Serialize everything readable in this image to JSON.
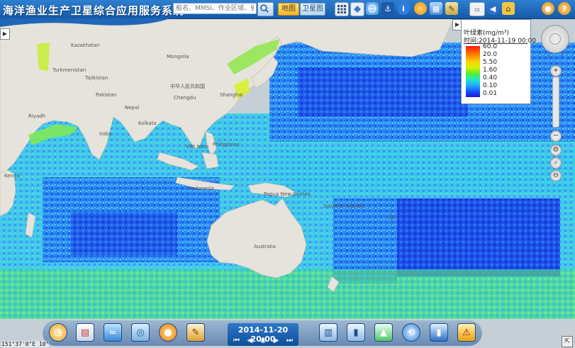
{
  "header": {
    "title": "海洋渔业生产卫星综合应用服务系统",
    "search_placeholder": "船名、MMSI、作业区域、省市",
    "tab_map": "地图",
    "tab_satellite": "卫星图",
    "tools": [
      "grid-icon",
      "layers-icon",
      "globe-icon",
      "anchor-icon",
      "info-icon",
      "weather-icon",
      "ruler-icon",
      "home-icon",
      "fishing-icon",
      "user-icon",
      "help-icon"
    ]
  },
  "legend": {
    "title": "叶绿素(mg/m³)",
    "time": "时间:2014-11-19 00:00",
    "values": [
      "60.0",
      "20.0",
      "5.50",
      "1.60",
      "0.40",
      "0.10",
      "0.01"
    ]
  },
  "map": {
    "labels": [
      "中华人民共和国",
      "Chengdu",
      "Shanghai",
      "India",
      "Nepal",
      "Pakistan",
      "Tajikistan",
      "Turkmenistan",
      "Kazakhstan",
      "Mongolia",
      "Kolkata",
      "Việt Nam",
      "Philippines",
      "Indonesia",
      "Papua New Guinea",
      "Australia",
      "Kenya",
      "Riyadh",
      "Solomon Islands",
      "Fiji"
    ],
    "layer": "chlorophyll-concentration"
  },
  "playback": {
    "datetime": "2014-11-20 20:00"
  },
  "status": {
    "coordinates": "151°37'0\"E 10°"
  },
  "bottom_tools": [
    "clock-icon",
    "report-icon",
    "wave-icon",
    "current-icon",
    "temperature-icon",
    "edit-icon",
    "station-icon",
    "thermometer-icon",
    "chlorophyll-icon",
    "wind-icon",
    "salinity-icon",
    "warning-icon"
  ]
}
